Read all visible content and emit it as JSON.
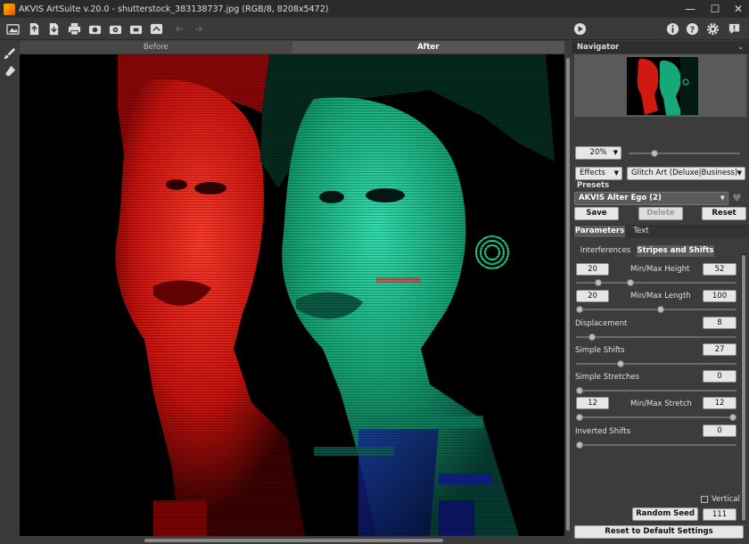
{
  "window": {
    "title": "AKVIS ArtSuite v.20.0 - shutterstock_383138737.jpg (RGB/8, 8208x5472)",
    "minimize_icon": "minimize-icon",
    "maximize_icon": "maximize-icon",
    "close_icon": "close-icon"
  },
  "toolbar": {
    "icons": [
      "home-icon",
      "open-icon",
      "save-icon",
      "print-icon",
      "batch-icon",
      "preset-import-icon",
      "preset-export-icon",
      "share-icon",
      "undo-icon",
      "redo-icon"
    ],
    "right_icons": [
      "run-icon",
      "info-icon",
      "help-icon",
      "settings-icon",
      "notification-icon"
    ]
  },
  "view_tabs": {
    "before": "Before",
    "after": "After"
  },
  "navigator": {
    "title": "Navigator",
    "zoom": "20%"
  },
  "effects": {
    "label": "Effects",
    "selected": "Glitch Art (Deluxe|Business)"
  },
  "presets": {
    "title": "Presets",
    "selected": "AKVIS Alter Ego (2)",
    "save": "Save",
    "delete": "Delete",
    "reset": "Reset"
  },
  "tabs": {
    "parameters": "Parameters",
    "text": "Text"
  },
  "subtabs": {
    "interferences": "Interferences",
    "stripes": "Stripes and Shifts"
  },
  "params": {
    "minmax_height": {
      "label": "Min/Max Height",
      "min": "20",
      "max": "52",
      "min_frac": 0.12,
      "max_frac": 0.33
    },
    "minmax_length": {
      "label": "Min/Max Length",
      "min": "20",
      "max": "100",
      "min_frac": 0.0,
      "max_frac": 0.53
    },
    "displacement": {
      "label": "Displacement",
      "value": "8",
      "frac": 0.08
    },
    "simple_shifts": {
      "label": "Simple Shifts",
      "value": "27",
      "frac": 0.27
    },
    "simple_stretches": {
      "label": "Simple Stretches",
      "value": "0",
      "frac": 0.0
    },
    "minmax_stretch": {
      "label": "Min/Max Stretch",
      "min": "12",
      "max": "12",
      "min_frac": 0.0,
      "max_frac": 1.0
    },
    "inverted_shifts": {
      "label": "Inverted Shifts",
      "value": "0",
      "frac": 0.0
    }
  },
  "vertical": {
    "label": "Vertical",
    "checked": false
  },
  "seed": {
    "button": "Random Seed",
    "value": "111"
  },
  "reset_defaults": "Reset to Default Settings"
}
